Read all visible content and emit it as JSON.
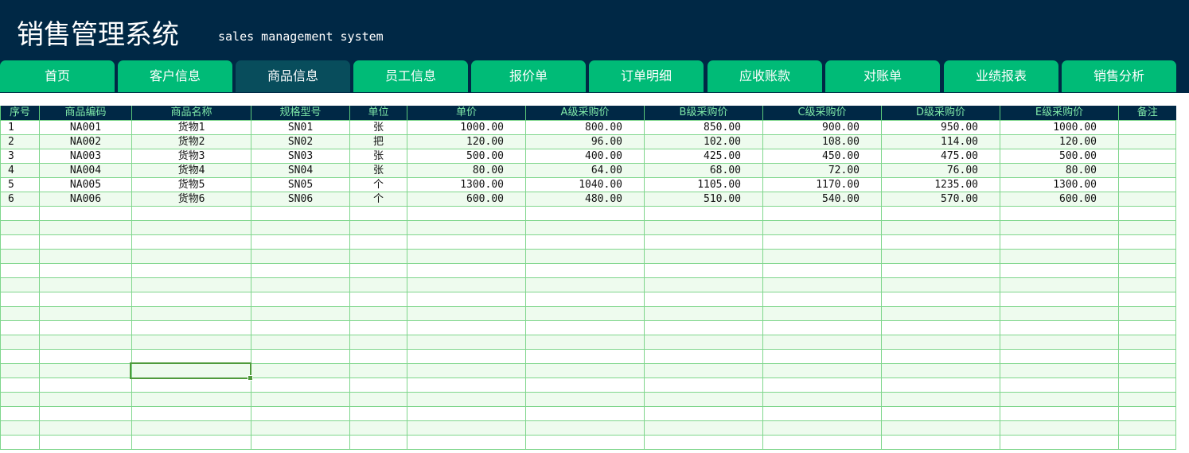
{
  "app": {
    "title": "销售管理系统",
    "subtitle": "sales management system"
  },
  "colors": {
    "header_bg": "#002845",
    "tab_bg": "#00bb77",
    "tab_active_bg": "#084d5c",
    "column_header_text": "#7fe8a8",
    "grid_line": "#7fd68c",
    "row_alt_bg": "#eefbee"
  },
  "tabs": [
    {
      "label": "首页",
      "active": false
    },
    {
      "label": "客户信息",
      "active": false
    },
    {
      "label": "商品信息",
      "active": true
    },
    {
      "label": "员工信息",
      "active": false
    },
    {
      "label": "报价单",
      "active": false
    },
    {
      "label": "订单明细",
      "active": false
    },
    {
      "label": "应收账款",
      "active": false
    },
    {
      "label": "对账单",
      "active": false
    },
    {
      "label": "业绩报表",
      "active": false
    },
    {
      "label": "销售分析",
      "active": false
    }
  ],
  "table": {
    "columns": [
      "序号",
      "商品编码",
      "商品名称",
      "规格型号",
      "单位",
      "单价",
      "A级采购价",
      "B级采购价",
      "C级采购价",
      "D级采购价",
      "E级采购价",
      "备注"
    ],
    "rows": [
      [
        "1",
        "NA001",
        "货物1",
        "SN01",
        "张",
        "1000.00",
        "800.00",
        "850.00",
        "900.00",
        "950.00",
        "1000.00",
        ""
      ],
      [
        "2",
        "NA002",
        "货物2",
        "SN02",
        "把",
        "120.00",
        "96.00",
        "102.00",
        "108.00",
        "114.00",
        "120.00",
        ""
      ],
      [
        "3",
        "NA003",
        "货物3",
        "SN03",
        "张",
        "500.00",
        "400.00",
        "425.00",
        "450.00",
        "475.00",
        "500.00",
        ""
      ],
      [
        "4",
        "NA004",
        "货物4",
        "SN04",
        "张",
        "80.00",
        "64.00",
        "68.00",
        "72.00",
        "76.00",
        "80.00",
        ""
      ],
      [
        "5",
        "NA005",
        "货物5",
        "SN05",
        "个",
        "1300.00",
        "1040.00",
        "1105.00",
        "1170.00",
        "1235.00",
        "1300.00",
        ""
      ],
      [
        "6",
        "NA006",
        "货物6",
        "SN06",
        "个",
        "600.00",
        "480.00",
        "510.00",
        "540.00",
        "570.00",
        "600.00",
        ""
      ]
    ],
    "empty_rows": 17
  }
}
